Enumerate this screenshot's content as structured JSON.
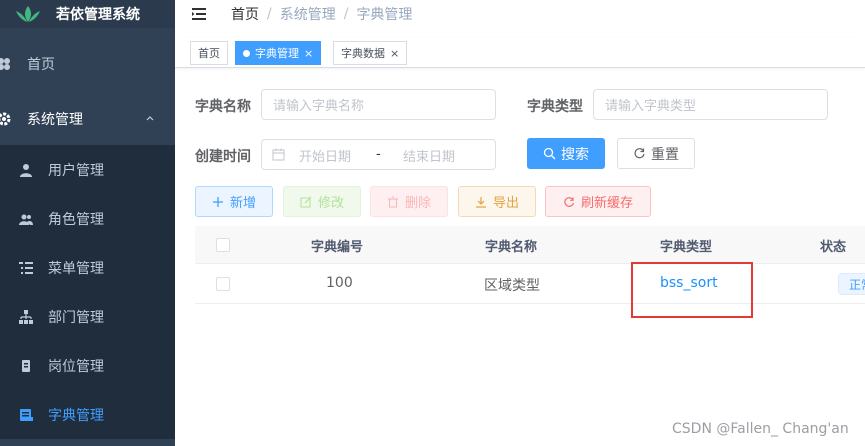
{
  "app": {
    "title": "若依管理系统"
  },
  "sidebar": {
    "items": [
      {
        "label": "首页",
        "icon": "dashboard-icon"
      },
      {
        "label": "系统管理",
        "icon": "gear-icon",
        "expanded": true
      },
      {
        "label": "用户管理",
        "icon": "user-icon"
      },
      {
        "label": "角色管理",
        "icon": "peoples-icon"
      },
      {
        "label": "菜单管理",
        "icon": "tree-table-icon"
      },
      {
        "label": "部门管理",
        "icon": "tree-icon"
      },
      {
        "label": "岗位管理",
        "icon": "post-icon"
      },
      {
        "label": "字典管理",
        "icon": "dict-icon",
        "active": true
      }
    ]
  },
  "breadcrumb": [
    "首页",
    "系统管理",
    "字典管理"
  ],
  "breadcrumb_sep": "/",
  "tags": [
    {
      "label": "首页"
    },
    {
      "label": "字典管理",
      "active": true,
      "close": "×"
    },
    {
      "label": "字典数据",
      "close": "×"
    }
  ],
  "search": {
    "dict_name_label": "字典名称",
    "dict_name_placeholder": "请输入字典名称",
    "dict_type_label": "字典类型",
    "dict_type_placeholder": "请输入字典类型",
    "create_time_label": "创建时间",
    "start_placeholder": "开始日期",
    "range_separator": "-",
    "end_placeholder": "结束日期",
    "search_label": "搜索",
    "reset_label": "重置"
  },
  "toolbar": {
    "add_label": "新增",
    "edit_label": "修改",
    "delete_label": "删除",
    "export_label": "导出",
    "refresh_cache_label": "刷新缓存"
  },
  "table": {
    "headers": [
      "字典编号",
      "字典名称",
      "字典类型",
      "状态"
    ],
    "rows": [
      {
        "dict_id": "100",
        "dict_name": "区域类型",
        "dict_type": "bss_sort",
        "status": "正常"
      }
    ]
  },
  "watermark": "CSDN @Fallen_ Chang'an",
  "colors": {
    "sidebar_bg": "#304156",
    "submenu_bg": "#1f2d3d",
    "primary": "#409eff",
    "highlight_box": "#e53935"
  }
}
